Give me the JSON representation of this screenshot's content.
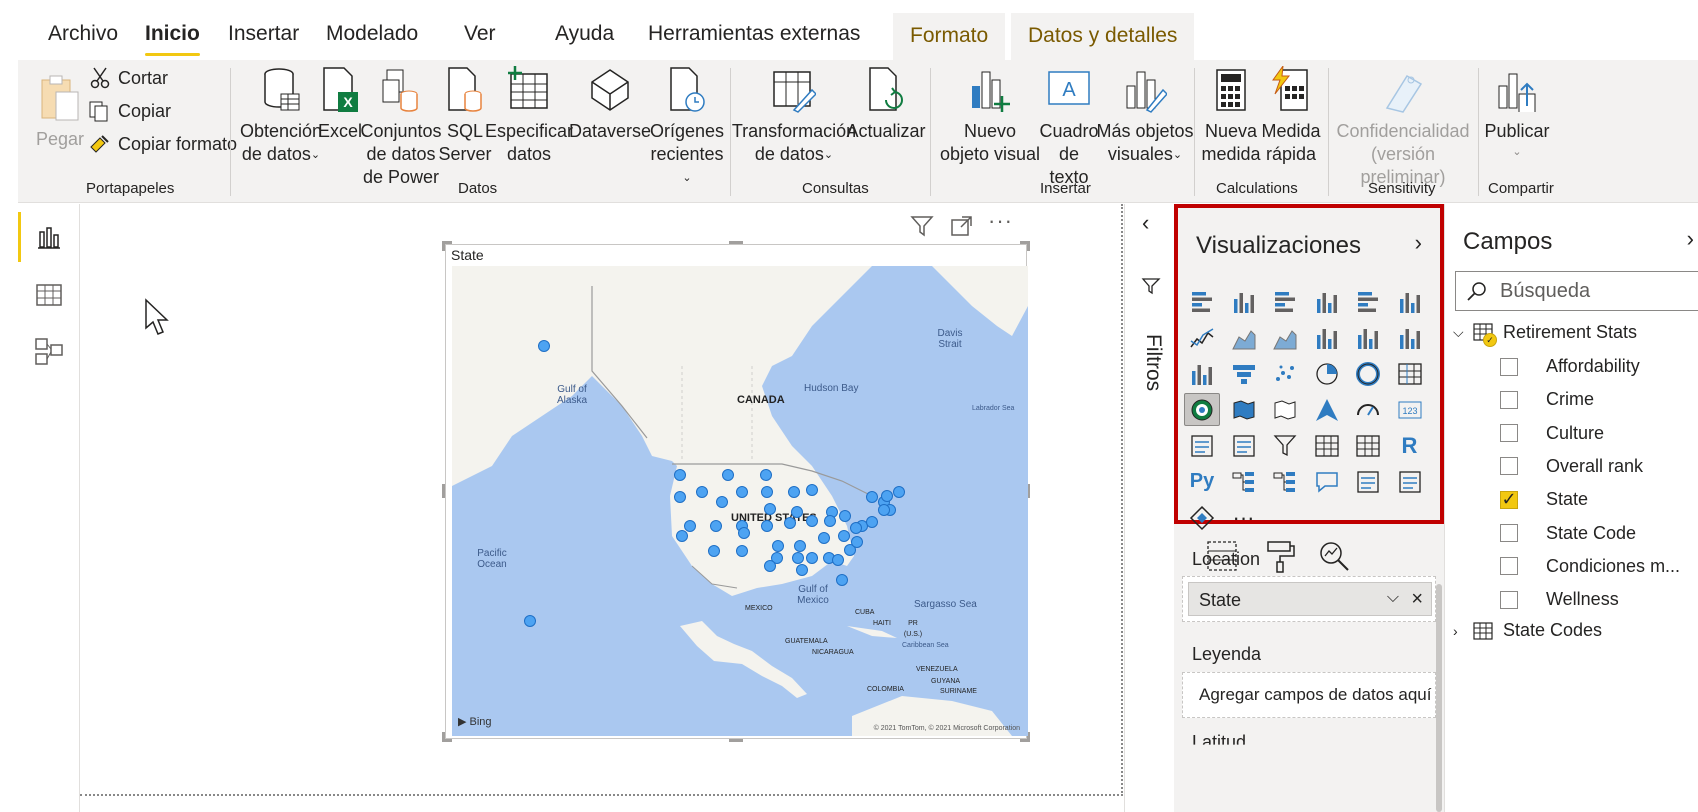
{
  "tabs": {
    "archivo": "Archivo",
    "inicio": "Inicio",
    "insertar": "Insertar",
    "modelado": "Modelado",
    "ver": "Ver",
    "ayuda": "Ayuda",
    "herramientas": "Herramientas externas",
    "formato": "Formato",
    "datos_detalles": "Datos y detalles"
  },
  "ribbon": {
    "pegar": "Pegar",
    "cortar": "Cortar",
    "copiar": "Copiar",
    "copiar_formato": "Copiar formato",
    "portapapeles": "Portapapeles",
    "obtencion_1": "Obtención",
    "obtencion_2": "de datos",
    "excel": "Excel",
    "conjuntos_1": "Conjuntos",
    "conjuntos_2": "de datos",
    "conjuntos_3": "de Power",
    "sql_1": "SQL",
    "sql_2": "Server",
    "especificar_1": "Especificar",
    "especificar_2": "datos",
    "dataverse": "Dataverse",
    "origenes_1": "Orígenes",
    "origenes_2": "recientes",
    "datos_group": "Datos",
    "transformacion_1": "Transformación",
    "transformacion_2": "de datos",
    "actualizar": "Actualizar",
    "consultas": "Consultas",
    "nuevo_1": "Nuevo",
    "nuevo_2": "objeto visual",
    "cuadro_1": "Cuadro",
    "cuadro_2": "de texto",
    "mas_1": "Más objetos",
    "mas_2": "visuales",
    "insertar_group": "Insertar",
    "nueva_1": "Nueva",
    "nueva_2": "medida",
    "medida_1": "Medida",
    "medida_2": "rápida",
    "calculations": "Calculations",
    "conf_1": "Confidencialidad",
    "conf_2": "(versión preliminar)",
    "sensitivity": "Sensitivity",
    "publicar": "Publicar",
    "compartir": "Compartir"
  },
  "visual": {
    "title": "State",
    "labels": {
      "canada": "CANADA",
      "us": "UNITED STATES",
      "mexico": "MEXICO",
      "cuba": "CUBA",
      "haiti": "HAITI",
      "pr": "PR (U.S.)",
      "guatemala": "GUATEMALA",
      "nicaragua": "NICARAGUA",
      "venezuela": "VENEZUELA",
      "guyana": "GUYANA",
      "suriname": "SURINAME",
      "colombia": "COLOMBIA",
      "gulf_alaska": "Gulf of Alaska",
      "hudson": "Hudson Bay",
      "davis": "Davis Strait",
      "labrador": "Labrador Sea",
      "pacific": "Pacific Ocean",
      "gulf_mexico": "Gulf of Mexico",
      "sargasso": "Sargasso Sea",
      "caribbean": "Caribbean Sea"
    },
    "bing": "Bing",
    "copyright": "© 2021 TomTom, © 2021 Microsoft Corporation"
  },
  "filters": {
    "label": "Filtros"
  },
  "visualizations": {
    "title": "Visualizaciones",
    "wells": {
      "location_label": "Location",
      "location_value": "State",
      "leyenda_label": "Leyenda",
      "leyenda_placeholder": "Agregar campos de datos aquí",
      "latitud_label": "Latitud"
    }
  },
  "fields": {
    "title": "Campos",
    "search_placeholder": "Búsqueda",
    "tables": [
      {
        "name": "Retirement Stats",
        "fields": [
          {
            "name": "Affordability",
            "checked": false
          },
          {
            "name": "Crime",
            "checked": false
          },
          {
            "name": "Culture",
            "checked": false
          },
          {
            "name": "Overall rank",
            "checked": false
          },
          {
            "name": "State",
            "checked": true
          },
          {
            "name": "State Code",
            "checked": false
          },
          {
            "name": "Condiciones m...",
            "checked": false
          },
          {
            "name": "Wellness",
            "checked": false
          }
        ]
      },
      {
        "name": "State Codes",
        "fields": []
      }
    ]
  },
  "colors": {
    "accent": "#f2c811",
    "highlight_border": "#c00000",
    "map_water": "#aac8f0",
    "map_land": "#f4f3ee",
    "dot": "#4da3f2"
  }
}
